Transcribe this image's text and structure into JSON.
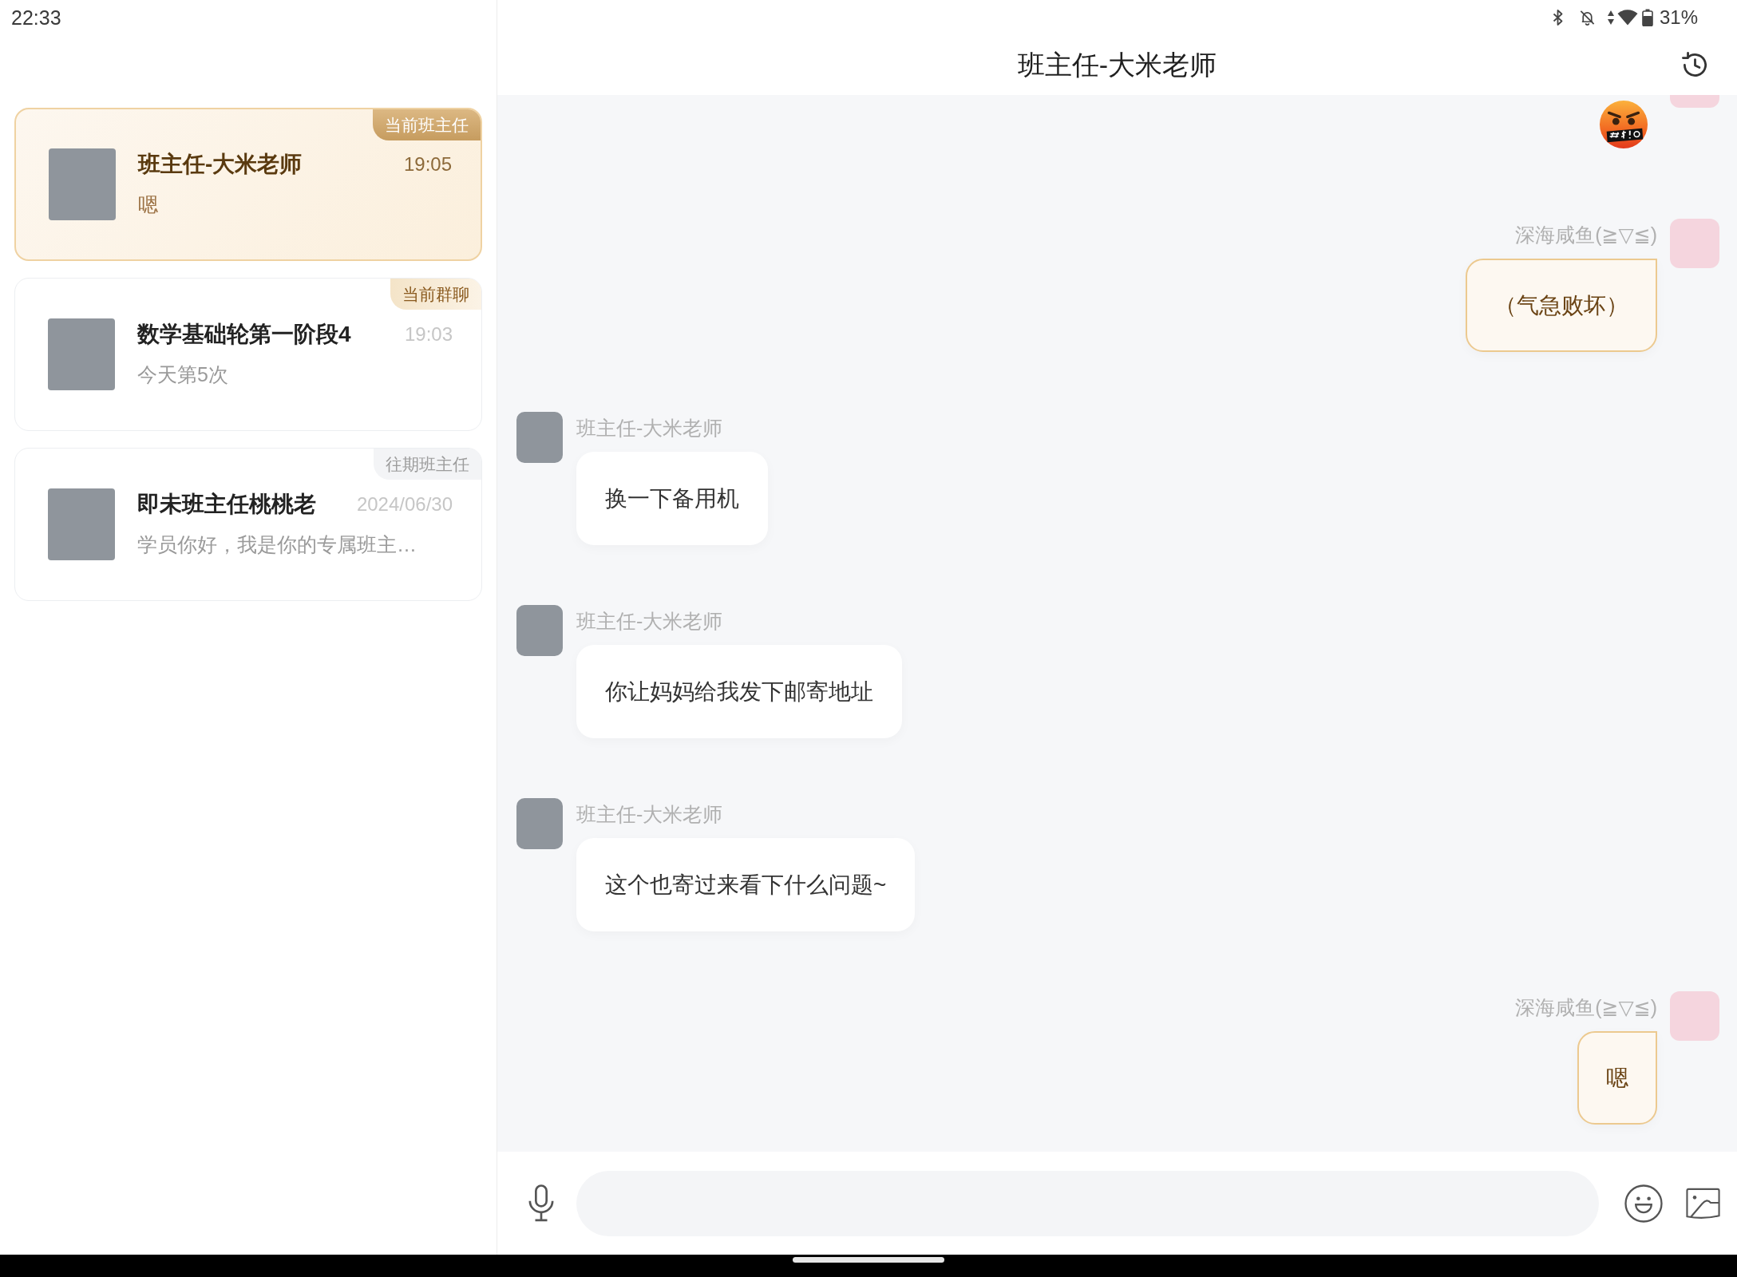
{
  "status_bar": {
    "time": "22:33",
    "battery": "31%"
  },
  "conversations": [
    {
      "name": "班主任-大米老师",
      "time": "19:05",
      "preview": "嗯",
      "tag": {
        "label": "当前班主任",
        "kind": "current"
      },
      "selected": true
    },
    {
      "name": "数学基础轮第一阶段4",
      "time": "19:03",
      "preview": "今天第5次",
      "tag": {
        "label": "当前群聊",
        "kind": "group"
      },
      "selected": false
    },
    {
      "name": "即未班主任桃桃老",
      "time": "2024/06/30",
      "preview": "学员你好，我是你的专属班主…",
      "tag": {
        "label": "往期班主任",
        "kind": "past"
      },
      "selected": false
    }
  ],
  "chat": {
    "title": "班主任-大米老师",
    "messages": [
      {
        "kind": "emoji",
        "outgoing": true
      },
      {
        "kind": "text",
        "outgoing": true,
        "name": "深海咸鱼(≧▽≦)",
        "text": "（气急败坏）"
      },
      {
        "kind": "text",
        "outgoing": false,
        "name": "班主任-大米老师",
        "text": "换一下备用机"
      },
      {
        "kind": "text",
        "outgoing": false,
        "name": "班主任-大米老师",
        "text": "你让妈妈给我发下邮寄地址"
      },
      {
        "kind": "text",
        "outgoing": false,
        "name": "班主任-大米老师",
        "text": "这个也寄过来看下什么问题~"
      },
      {
        "kind": "text",
        "outgoing": true,
        "name": "深海咸鱼(≧▽≦)",
        "text": "嗯"
      }
    ]
  }
}
